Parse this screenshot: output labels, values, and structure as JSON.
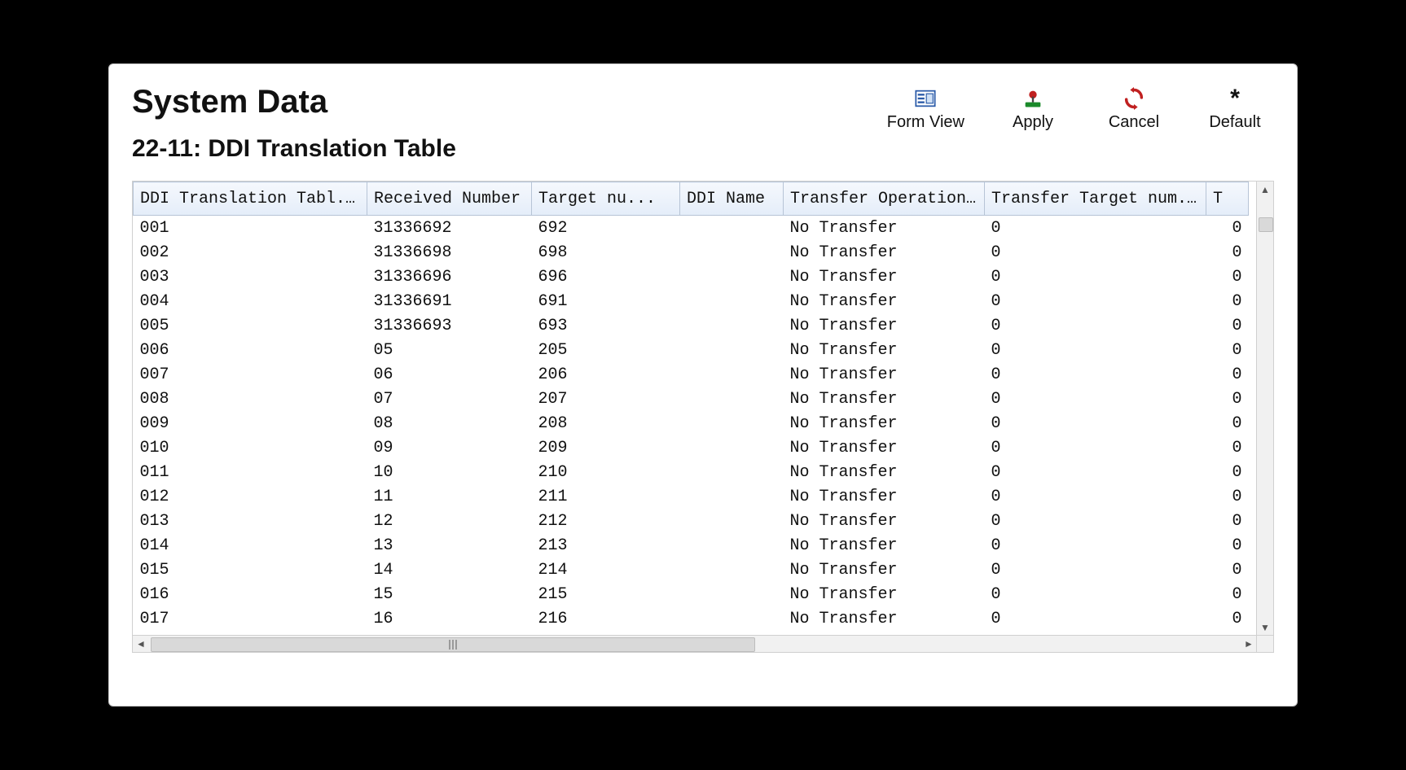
{
  "header": {
    "title": "System Data",
    "subtitle": "22-11: DDI Translation Table"
  },
  "toolbar": {
    "form_view": "Form View",
    "apply": "Apply",
    "cancel": "Cancel",
    "default": "Default"
  },
  "table": {
    "columns": [
      "DDI Translation Tabl...",
      "Received Number",
      "Target nu...",
      "DDI Name",
      "Transfer Operation ...",
      "Transfer Target num...",
      "T"
    ],
    "rows": [
      {
        "idx": "001",
        "recv": "31336692",
        "target": "692",
        "name": "",
        "op": "No Transfer",
        "tnum": "0",
        "t": "0"
      },
      {
        "idx": "002",
        "recv": "31336698",
        "target": "698",
        "name": "",
        "op": "No Transfer",
        "tnum": "0",
        "t": "0"
      },
      {
        "idx": "003",
        "recv": "31336696",
        "target": "696",
        "name": "",
        "op": "No Transfer",
        "tnum": "0",
        "t": "0"
      },
      {
        "idx": "004",
        "recv": "31336691",
        "target": "691",
        "name": "",
        "op": "No Transfer",
        "tnum": "0",
        "t": "0"
      },
      {
        "idx": "005",
        "recv": "31336693",
        "target": "693",
        "name": "",
        "op": "No Transfer",
        "tnum": "0",
        "t": "0"
      },
      {
        "idx": "006",
        "recv": "05",
        "target": "205",
        "name": "",
        "op": "No Transfer",
        "tnum": "0",
        "t": "0"
      },
      {
        "idx": "007",
        "recv": "06",
        "target": "206",
        "name": "",
        "op": "No Transfer",
        "tnum": "0",
        "t": "0"
      },
      {
        "idx": "008",
        "recv": "07",
        "target": "207",
        "name": "",
        "op": "No Transfer",
        "tnum": "0",
        "t": "0"
      },
      {
        "idx": "009",
        "recv": "08",
        "target": "208",
        "name": "",
        "op": "No Transfer",
        "tnum": "0",
        "t": "0"
      },
      {
        "idx": "010",
        "recv": "09",
        "target": "209",
        "name": "",
        "op": "No Transfer",
        "tnum": "0",
        "t": "0"
      },
      {
        "idx": "011",
        "recv": "10",
        "target": "210",
        "name": "",
        "op": "No Transfer",
        "tnum": "0",
        "t": "0"
      },
      {
        "idx": "012",
        "recv": "11",
        "target": "211",
        "name": "",
        "op": "No Transfer",
        "tnum": "0",
        "t": "0"
      },
      {
        "idx": "013",
        "recv": "12",
        "target": "212",
        "name": "",
        "op": "No Transfer",
        "tnum": "0",
        "t": "0"
      },
      {
        "idx": "014",
        "recv": "13",
        "target": "213",
        "name": "",
        "op": "No Transfer",
        "tnum": "0",
        "t": "0"
      },
      {
        "idx": "015",
        "recv": "14",
        "target": "214",
        "name": "",
        "op": "No Transfer",
        "tnum": "0",
        "t": "0"
      },
      {
        "idx": "016",
        "recv": "15",
        "target": "215",
        "name": "",
        "op": "No Transfer",
        "tnum": "0",
        "t": "0"
      },
      {
        "idx": "017",
        "recv": "16",
        "target": "216",
        "name": "",
        "op": "No Transfer",
        "tnum": "0",
        "t": "0"
      }
    ]
  }
}
